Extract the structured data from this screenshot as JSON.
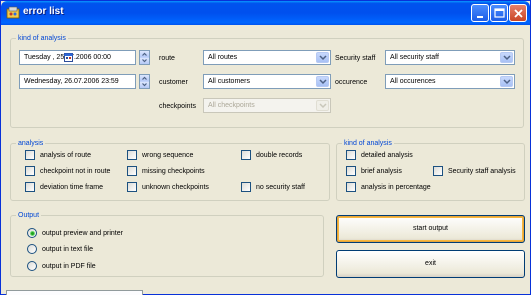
{
  "window": {
    "title": "error list"
  },
  "kind_of_analysis_top": {
    "legend": "kind of analysis",
    "from_date": "Tuesday  , 25.07.2006   00:00",
    "to_date": "Wednesday, 26.07.2006   23:59",
    "route_label": "route",
    "route_value": "All routes",
    "customer_label": "customer",
    "customer_value": "All customers",
    "checkpoints_label": "checkpoints",
    "checkpoints_value": "All checkpoints",
    "security_staff_label": "Security staff",
    "security_staff_value": "All security staff",
    "occurence_label": "occurence",
    "occurence_value": "All occurences"
  },
  "analysis": {
    "legend": "analysis",
    "items": [
      "analysis of route",
      "checkpoint not in route",
      "deviation time frame",
      "wrong sequence",
      "missing checkpoints",
      "unknown checkpoints",
      "double records",
      "no security staff"
    ]
  },
  "kind_of_analysis_right": {
    "legend": "kind of analysis",
    "items": [
      "detailed analysis",
      "brief analysis",
      "Security staff analysis",
      "analysis in percentage"
    ]
  },
  "output": {
    "legend": "Output",
    "options": [
      "output preview and printer",
      "output in text file",
      "output in PDF file"
    ],
    "selected": "output preview and printer"
  },
  "buttons": {
    "start": "start output",
    "exit": "exit"
  },
  "colors": {
    "titlebar": "#0053ee",
    "legend_text": "#0046d5",
    "window_bg": "#ece9d8",
    "radio_selected": "#21a121"
  },
  "icons": {
    "app": "app-icon",
    "minimize": "minimize-icon",
    "maximize": "maximize-icon",
    "close": "close-icon",
    "calendar": "calendar-icon",
    "dropdown": "chevron-down-icon",
    "spin": "spinner-icon"
  }
}
